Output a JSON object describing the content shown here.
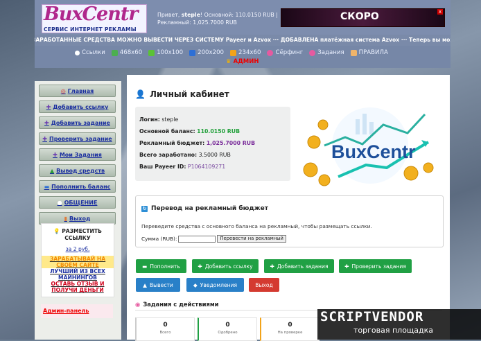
{
  "header": {
    "logo_main": "BuxCentr",
    "logo_sub": "СЕРВИС ИНТЕРНЕТ РЕКЛАМЫ",
    "greeting_prefix": "Привет, ",
    "username": "steple",
    "greeting_suffix": "! Основной: 110.0150 RUB |",
    "ad_balance_line": "Рекламный: 1,025.7000 RUB",
    "banner_text": "СКОРО",
    "banner_close": "x"
  },
  "ticker": "ЗАРАБОТАННЫЕ СРЕДСТВА МОЖНО ВЫВЕСТИ ЧЕРЕЗ СИСТЕМУ Payeer и Azvox  ···  ДОБАВЛЕНА платёжная система Azvox  ···  Теперь вы можете покупать рекламу",
  "nav": {
    "items": [
      "Ссылки",
      "468x60",
      "100x100",
      "200x200",
      "234x60",
      "Сёрфинг",
      "Задания",
      "ПРАВИЛА"
    ],
    "admin": "АДМИН"
  },
  "sidebar": {
    "menu": [
      "Главная",
      "Добавить ссылку",
      "Добавить задание",
      "Проверить задание",
      "Мои Задания",
      "Вывод средств",
      "Пополнить баланс",
      "ОБЩЕНИЕ",
      "Выход"
    ],
    "promo_title": "РАЗМЕСТИТЬ ССЫЛКУ",
    "promo_price": "за 2 руб.",
    "promo_lines": [
      "ЗАРАБАТЫВАЙ НА",
      "СВОЁМ САЙТЕ",
      "ЛУЧШИЙ ИЗ ВСЕХ",
      "МАЙНИНГОВ",
      "ОСТАВЬ ОТЗЫВ И",
      "ПОЛУЧИ ДЕНЬГИ"
    ],
    "admin_panel": "Админ-панель"
  },
  "main": {
    "title": "Личный кабинет",
    "login_label": "Логин:",
    "login_value": "steple",
    "balance_label": "Основной баланс:",
    "balance_value": "110.0150 RUB",
    "ad_label": "Рекламный бюджет:",
    "ad_value": "1,025.7000 RUB",
    "earned_label": "Всего заработано:",
    "earned_value": "3.5000 RUB",
    "payeer_label": "Ваш Payeer ID:",
    "payeer_value": "P1064109271",
    "illus_text": "BuxCentr",
    "transfer": {
      "title": "Перевод на рекламный бюджет",
      "desc": "Переведите средства с основного баланса на рекламный, чтобы размещать ссылки.",
      "sum_label": "Сумма (RUB):",
      "input_value": "",
      "button": "Перевести на рекламный"
    },
    "actions": [
      "Пополнить",
      "Добавить ссылку",
      "Добавить задания",
      "Проверить задания",
      "Вывести",
      "Уведомления",
      "Выход"
    ],
    "tasks_title": "Задания с действиями",
    "stats": [
      {
        "value": "0",
        "label": "Всего"
      },
      {
        "value": "0",
        "label": "Одобрено"
      },
      {
        "value": "0",
        "label": "На проверке"
      }
    ]
  },
  "watermark": {
    "top": "SCRIPTVENDOR",
    "bottom": "торговая площадка"
  },
  "colors": {
    "accent_green": "#20a044",
    "accent_blue": "#2980c8",
    "danger": "#d43a30",
    "brand_purple": "#b0278c"
  }
}
